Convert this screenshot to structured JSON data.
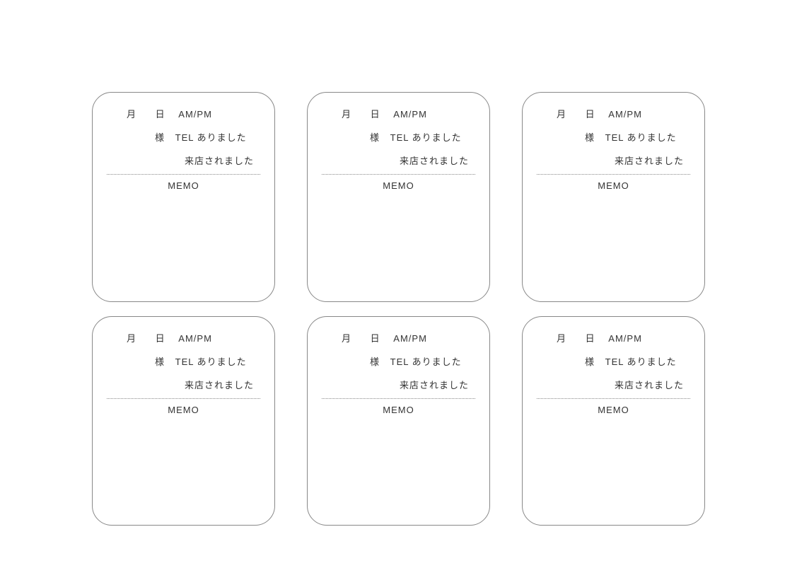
{
  "card": {
    "month_label": "月",
    "day_label": "日",
    "ampm_label": "AM/PM",
    "sama_label": "様",
    "tel_label": "TEL ありました",
    "visit_label": "来店されました",
    "memo_label": "MEMO"
  }
}
